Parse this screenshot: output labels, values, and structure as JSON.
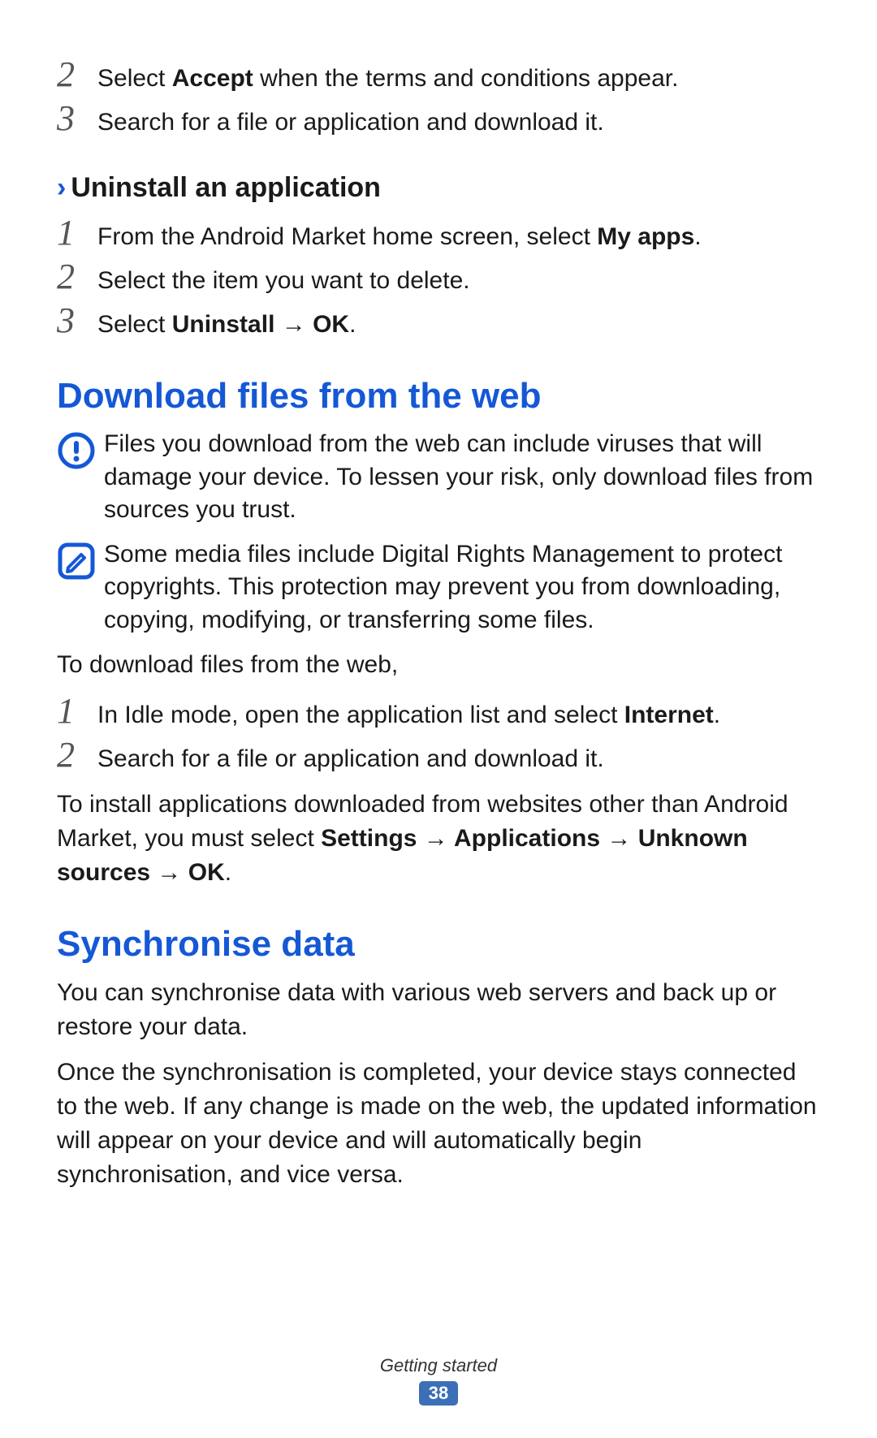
{
  "top_steps": [
    {
      "n": "2",
      "pre": "Select ",
      "bold1": "Accept",
      "post": " when the terms and conditions appear."
    },
    {
      "n": "3",
      "pre": "Search for a file or application and download it.",
      "bold1": "",
      "post": ""
    }
  ],
  "uninstall": {
    "chevron": "›",
    "title": "Uninstall an application",
    "steps": [
      {
        "n": "1",
        "pre": "From the Android Market home screen, select ",
        "bold1": "My apps",
        "post": "."
      },
      {
        "n": "2",
        "pre": "Select the item you want to delete.",
        "bold1": "",
        "post": ""
      },
      {
        "n": "3",
        "pre": "Select ",
        "bold1": "Uninstall",
        "mid": " → ",
        "bold2": "OK",
        "post": "."
      }
    ]
  },
  "download": {
    "heading": "Download files from the web",
    "warn": "Files you download from the web can include viruses that will damage your device. To lessen your risk, only download files from sources you trust.",
    "note": "Some media files include Digital Rights Management to protect copyrights. This protection may prevent you from downloading, copying, modifying, or transferring some files.",
    "intro": "To download files from the web,",
    "steps": [
      {
        "n": "1",
        "pre": "In Idle mode, open the application list and select ",
        "bold1": "Internet",
        "post": "."
      },
      {
        "n": "2",
        "pre": "Search for a file or application and download it.",
        "bold1": "",
        "post": ""
      }
    ],
    "install_pre": "To install applications downloaded from websites other than Android Market, you must select ",
    "install_bold": "Settings → Applications → Unknown sources → OK",
    "install_post": "."
  },
  "sync": {
    "heading": "Synchronise data",
    "p1": "You can synchronise data with various web servers and back up or restore your data.",
    "p2": "Once the synchronisation is completed, your device stays connected to the web. If any change is made on the web, the updated information will appear on your device and will automatically begin synchronisation, and vice versa."
  },
  "footer": {
    "section": "Getting started",
    "page": "38"
  }
}
